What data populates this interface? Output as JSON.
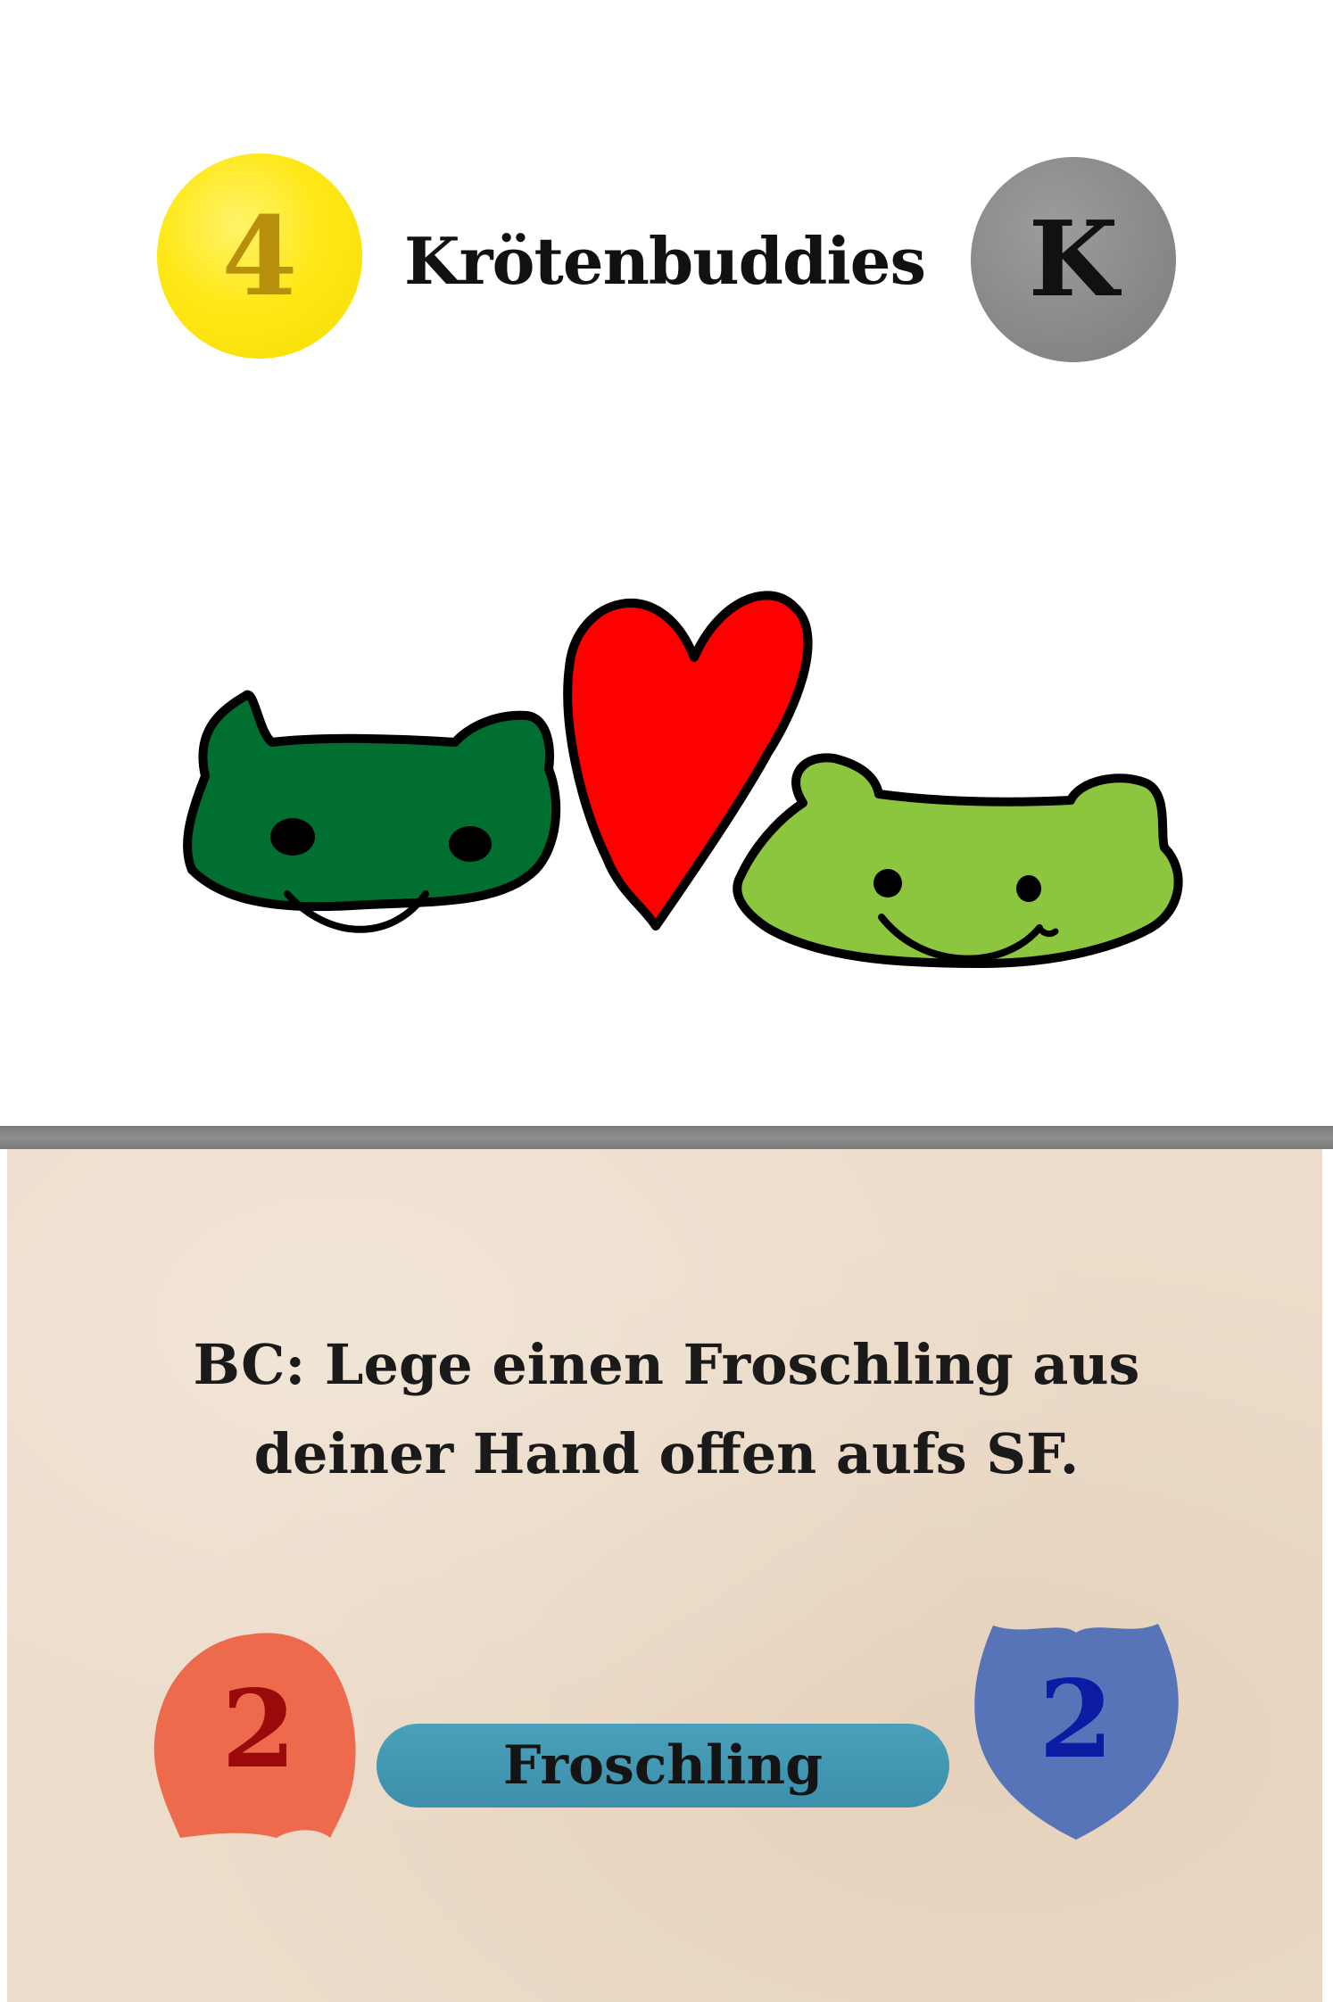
{
  "card": {
    "cost": "4",
    "title": "Krötenbuddies",
    "type_badge": "K",
    "ability": "BC: Lege einen Froschling aus deiner Hand offen aufs SF.",
    "attack": "2",
    "defense": "2",
    "subtype": "Froschling"
  },
  "colors": {
    "cost_circle": "#ffe817",
    "type_circle": "#8a8a8a",
    "attack_shape": "#ed6a4d",
    "attack_text": "#9b0a0a",
    "defense_shape": "#5874b8",
    "defense_text": "#0b1ca3",
    "subtype_pill": "#4298b3",
    "text_panel": "#ecdcc9",
    "divider": "#858585",
    "frog_dark": "#006f30",
    "frog_light": "#8cc63f",
    "heart": "#ff0000"
  },
  "art": {
    "icons": [
      "frog-dark-icon",
      "heart-icon",
      "frog-light-icon"
    ]
  }
}
